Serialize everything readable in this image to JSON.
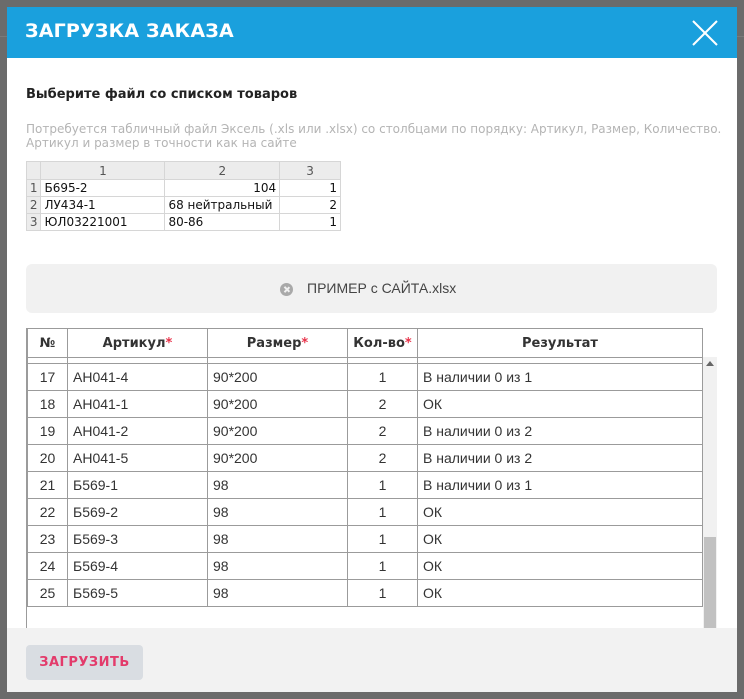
{
  "modal": {
    "title": "ЗАГРУЗКА ЗАКАЗА",
    "subtitle": "Выберите файл со списком товаров",
    "hint": "Потребуется табличный файл Эксель (.xls или .xlsx) со столбцами по порядку: Артикул, Размер, Количество. Артикул и размер в точности как на сайте"
  },
  "excel_preview": {
    "columns": [
      "1",
      "2",
      "3"
    ],
    "rows": [
      {
        "n": "1",
        "a": "Б695-2",
        "b": "104",
        "c": "1"
      },
      {
        "n": "2",
        "a": "ЛУ434-1",
        "b": "68 нейтральный",
        "c": "2"
      },
      {
        "n": "3",
        "a": "ЮЛ03221001",
        "b": "80-86",
        "c": "1"
      }
    ]
  },
  "file": {
    "name": "ПРИМЕР с САЙТА.xlsx"
  },
  "results": {
    "headers": {
      "num": "№",
      "article": "Артикул",
      "size": "Размер",
      "qty": "Кол-во",
      "result": "Результат",
      "required_mark": "*"
    },
    "rows": [
      {
        "num": "17",
        "article": "АН041-4",
        "size": "90*200",
        "qty": "1",
        "result": "В наличии 0 из 1"
      },
      {
        "num": "18",
        "article": "АН041-1",
        "size": "90*200",
        "qty": "2",
        "result": "ОК"
      },
      {
        "num": "19",
        "article": "АН041-2",
        "size": "90*200",
        "qty": "2",
        "result": "В наличии 0 из 2"
      },
      {
        "num": "20",
        "article": "АН041-5",
        "size": "90*200",
        "qty": "2",
        "result": "В наличии 0 из 2"
      },
      {
        "num": "21",
        "article": "Б569-1",
        "size": "98",
        "qty": "1",
        "result": "В наличии 0 из 1"
      },
      {
        "num": "22",
        "article": "Б569-2",
        "size": "98",
        "qty": "1",
        "result": "ОК"
      },
      {
        "num": "23",
        "article": "Б569-3",
        "size": "98",
        "qty": "1",
        "result": "ОК"
      },
      {
        "num": "24",
        "article": "Б569-4",
        "size": "98",
        "qty": "1",
        "result": "ОК"
      },
      {
        "num": "25",
        "article": "Б569-5",
        "size": "98",
        "qty": "1",
        "result": "ОК"
      }
    ]
  },
  "footer": {
    "upload_label": "ЗАГРУЗИТЬ"
  },
  "colors": {
    "header": "#1aa0dd",
    "accent": "#e33b6b",
    "required": "#e8334a"
  },
  "icons": {
    "close": "close-icon",
    "remove_file": "remove-file-icon",
    "scroll": "scroll-up-icon"
  }
}
